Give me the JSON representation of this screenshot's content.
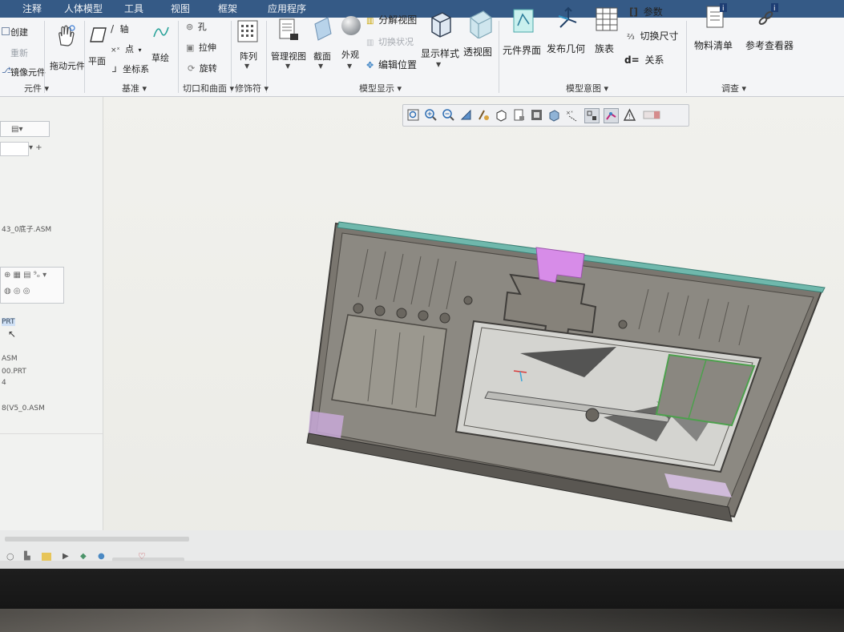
{
  "menu": {
    "tabs": [
      "注释",
      "人体模型",
      "工具",
      "视图",
      "框架",
      "应用程序"
    ]
  },
  "ribbon": {
    "operations": {
      "create": "创建",
      "redo": "重新",
      "mirror": "镜像元件"
    },
    "drag": "拖动元件",
    "datum": {
      "plane": "平面",
      "axis": "轴",
      "point": "点",
      "csys": "坐标系",
      "sketch": "草绘"
    },
    "cut": {
      "hole": "孔",
      "extrude": "拉伸",
      "revolve": "旋转"
    },
    "pattern": "阵列",
    "model_display": {
      "manage_views": "管理视图",
      "section": "截面",
      "appearance": "外观",
      "explode": "分解视图",
      "toggle_status": "切换状况",
      "edit_position": "编辑位置",
      "display_style": "显示样式",
      "perspective": "透视图"
    },
    "intent": {
      "component_interface": "元件界面",
      "publish_geometry": "发布几何",
      "family_table": "族表",
      "parameters": "参数",
      "switch_dims": "切换尺寸",
      "relations": "关系"
    },
    "investigate": {
      "bom": "物料清单",
      "reference_viewer": "参考查看器"
    },
    "groups": {
      "components": "元件",
      "datum": "基准",
      "cut_surface": "切口和曲面",
      "modifiers": "修饰符",
      "model_display": "模型显示",
      "model_intent": "模型意图",
      "investigate": "调查"
    }
  },
  "model_tree": {
    "items": [
      "43_0底子.ASM",
      "PRT",
      "ASM",
      "00.PRT",
      "4",
      "8(V5_0.ASM"
    ]
  },
  "colors": {
    "menubar": "#355a86",
    "ribbon": "#f4f5f7",
    "viewport": "#ecede8",
    "model_frame": "#7a766f",
    "model_inner": "#d4d4d0",
    "accent_magenta": "#d78ce8",
    "accent_teal": "#6fb8ac",
    "accent_green": "#4da04d"
  }
}
